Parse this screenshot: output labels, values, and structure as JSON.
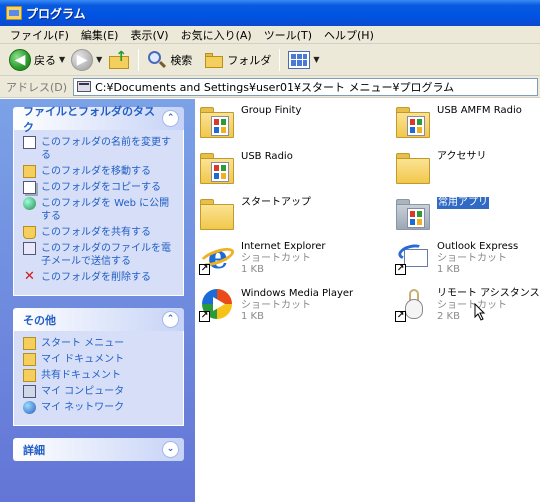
{
  "window": {
    "title": "プログラム"
  },
  "menu": [
    "ファイル(F)",
    "編集(E)",
    "表示(V)",
    "お気に入り(A)",
    "ツール(T)",
    "ヘルプ(H)"
  ],
  "toolbar": {
    "back_label": "戻る",
    "search_label": "検索",
    "folders_label": "フォルダ"
  },
  "address": {
    "label": "アドレス(D)",
    "path": "C:¥Documents and Settings¥user01¥スタート メニュー¥プログラム"
  },
  "tasks_panel": {
    "title": "ファイルとフォルダのタスク",
    "items": [
      "このフォルダの名前を変更する",
      "このフォルダを移動する",
      "このフォルダをコピーする",
      "このフォルダを Web に公開する",
      "このフォルダを共有する",
      "このフォルダのファイルを電子メールで送信する",
      "このフォルダを削除する"
    ]
  },
  "other_panel": {
    "title": "その他",
    "items": [
      "スタート メニュー",
      "マイ ドキュメント",
      "共有ドキュメント",
      "マイ コンピュータ",
      "マイ ネットワーク"
    ]
  },
  "details_panel": {
    "title": "詳細"
  },
  "files": [
    {
      "name": "Group Finity"
    },
    {
      "name": "USB AMFM Radio"
    },
    {
      "name": "USB Radio"
    },
    {
      "name": "アクセサリ"
    },
    {
      "name": "スタートアップ"
    },
    {
      "name": "常用アプリ"
    },
    {
      "name": "Internet Explorer",
      "type": "ショートカット",
      "size": "1 KB"
    },
    {
      "name": "Outlook Express",
      "type": "ショートカット",
      "size": "1 KB"
    },
    {
      "name": "Windows Media Player",
      "type": "ショートカット",
      "size": "1 KB"
    },
    {
      "name": "リモート アシスタンス",
      "type": "ショートカット",
      "size": "2 KB"
    }
  ],
  "colors": {
    "title_bar": "#0054e3",
    "task_pane": "#7ba2e7",
    "link": "#215dc6",
    "selection": "#316ac5"
  }
}
